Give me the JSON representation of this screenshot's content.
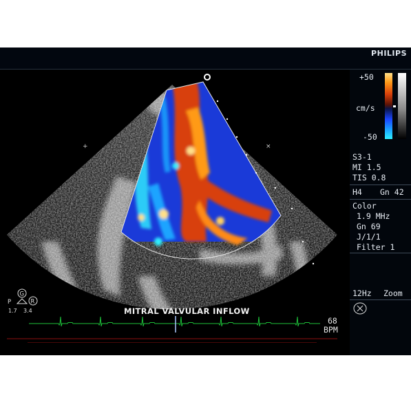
{
  "header": {
    "brand": "PHILIPS"
  },
  "color_scale": {
    "max_label": "+50",
    "unit_label": "cm/s",
    "min_label": "-50"
  },
  "probe": {
    "transducer": "S3-1",
    "mi": "MI 1.5",
    "tis": "TIS 0.8"
  },
  "imaging": {
    "mode": "H4",
    "gain": "Gn 42"
  },
  "color_doppler": {
    "title": "Color",
    "freq": "1.9 MHz",
    "gain": "Gn 69",
    "setting": "J/1/1",
    "filter": "Filter 1"
  },
  "frame_rate": {
    "rate": "12Hz",
    "zoom": "Zoom"
  },
  "annotation": {
    "text": "MITRAL VALVULAR INFLOW"
  },
  "heart_rate": {
    "value": "68",
    "unit": "BPM"
  },
  "orientation": {
    "g": "G",
    "p": "P",
    "r": "R",
    "left_val": "1.7",
    "right_val": "3.4"
  },
  "colors": {
    "ecg": "#1ec23a",
    "accent_red": "#d8400a",
    "accent_blue": "#1a46ff"
  }
}
